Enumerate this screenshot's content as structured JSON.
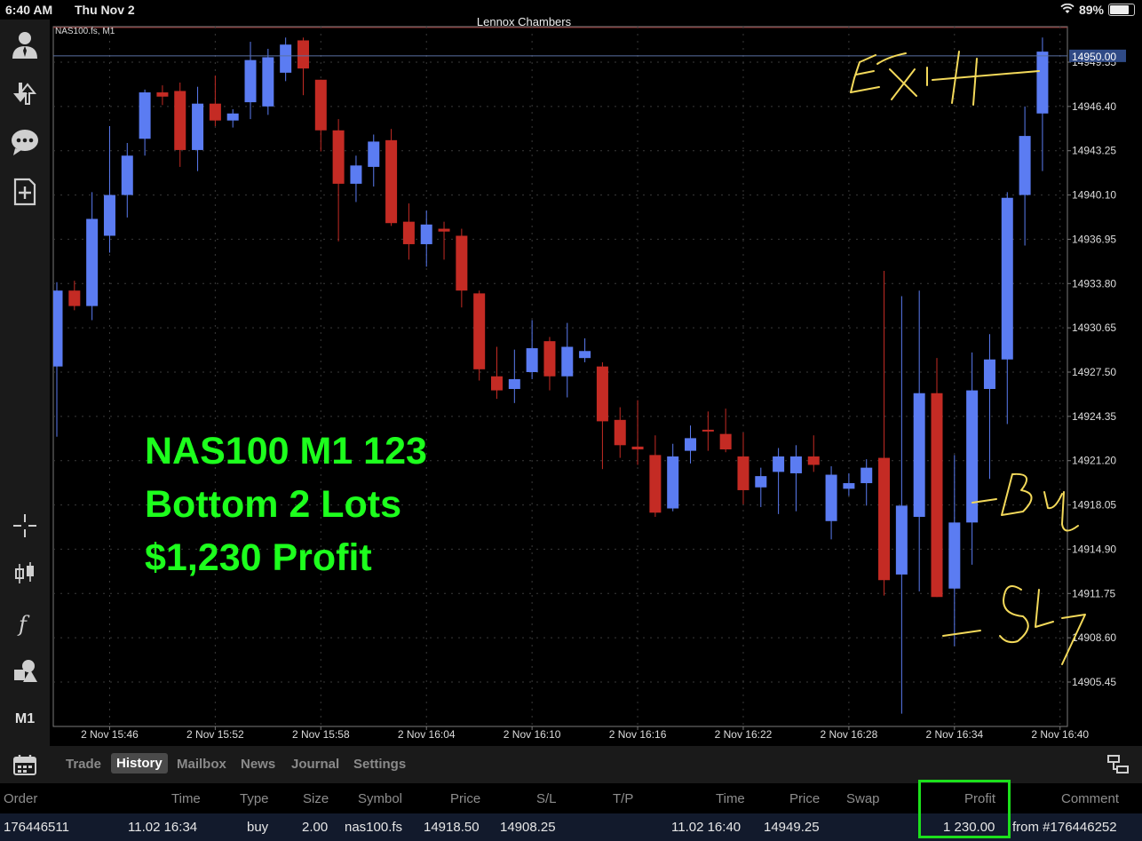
{
  "status_bar": {
    "time": "6:40 AM",
    "date": "Thu Nov 2",
    "battery": "89%",
    "battery_level": 0.89
  },
  "chart_header": {
    "account": "Lennox Chambers",
    "symbol": "NAS100.fs, M1"
  },
  "sidebar": {
    "tools": [
      "account-icon",
      "trade-icon",
      "chat-icon",
      "new-document-icon",
      "crosshair-icon",
      "candles-icon",
      "indicator-f-icon",
      "objects-icon"
    ],
    "timeframe": "M1"
  },
  "overlay": {
    "line1": "NAS100 M1 123",
    "line2": "Bottom 2 Lots",
    "line3": "$1,230 Profit"
  },
  "annotations": {
    "exit": "Exit",
    "buy": "Buy",
    "sl": "SL"
  },
  "colors": {
    "bull": "#5b7cf2",
    "bear": "#c42b24",
    "price_line": "#5a6fa3",
    "highlight": "#1ce01c",
    "overlay_text": "#1dff1d",
    "handwriting": "#f3d95a"
  },
  "chart_data": {
    "type": "candlestick",
    "current_price": "14950.00",
    "y_ticks": [
      "14949.55",
      "14946.40",
      "14943.25",
      "14940.10",
      "14936.95",
      "14933.80",
      "14930.65",
      "14927.50",
      "14924.35",
      "14921.20",
      "14918.05",
      "14914.90",
      "14911.75",
      "14908.60",
      "14905.45"
    ],
    "y_tick_values": [
      14949.55,
      14946.4,
      14943.25,
      14940.1,
      14936.95,
      14933.8,
      14930.65,
      14927.5,
      14924.35,
      14921.2,
      14918.05,
      14914.9,
      14911.75,
      14908.6,
      14905.45
    ],
    "ylim": [
      14902.8,
      14951.3
    ],
    "x_ticks": [
      "2 Nov 15:46",
      "2 Nov 15:52",
      "2 Nov 15:58",
      "2 Nov 16:04",
      "2 Nov 16:10",
      "2 Nov 16:16",
      "2 Nov 16:22",
      "2 Nov 16:28",
      "2 Nov 16:34",
      "2 Nov 16:40"
    ],
    "candles": [
      {
        "o": 14927.9,
        "h": 14933.9,
        "l": 14922.9,
        "c": 14933.3
      },
      {
        "o": 14933.3,
        "h": 14934.0,
        "l": 14931.9,
        "c": 14932.2
      },
      {
        "o": 14932.2,
        "h": 14940.3,
        "l": 14931.2,
        "c": 14938.4
      },
      {
        "o": 14937.2,
        "h": 14945.0,
        "l": 14936.0,
        "c": 14940.1
      },
      {
        "o": 14940.1,
        "h": 14943.8,
        "l": 14938.5,
        "c": 14942.9
      },
      {
        "o": 14944.1,
        "h": 14947.6,
        "l": 14942.9,
        "c": 14947.4
      },
      {
        "o": 14947.4,
        "h": 14947.9,
        "l": 14946.5,
        "c": 14947.1
      },
      {
        "o": 14947.5,
        "h": 14948.1,
        "l": 14942.1,
        "c": 14943.3
      },
      {
        "o": 14943.3,
        "h": 14947.8,
        "l": 14941.8,
        "c": 14946.6
      },
      {
        "o": 14946.6,
        "h": 14948.6,
        "l": 14945.0,
        "c": 14945.4
      },
      {
        "o": 14945.4,
        "h": 14946.2,
        "l": 14944.9,
        "c": 14945.9
      },
      {
        "o": 14946.7,
        "h": 14951.0,
        "l": 14945.5,
        "c": 14949.7
      },
      {
        "o": 14946.4,
        "h": 14950.5,
        "l": 14945.8,
        "c": 14949.9
      },
      {
        "o": 14948.8,
        "h": 14951.3,
        "l": 14948.2,
        "c": 14950.8
      },
      {
        "o": 14951.1,
        "h": 14951.3,
        "l": 14947.2,
        "c": 14949.1
      },
      {
        "o": 14948.3,
        "h": 14948.3,
        "l": 14943.2,
        "c": 14944.7
      },
      {
        "o": 14944.7,
        "h": 14945.5,
        "l": 14936.8,
        "c": 14940.9
      },
      {
        "o": 14940.9,
        "h": 14942.9,
        "l": 14939.6,
        "c": 14942.2
      },
      {
        "o": 14942.1,
        "h": 14944.4,
        "l": 14940.7,
        "c": 14943.9
      },
      {
        "o": 14944.0,
        "h": 14944.8,
        "l": 14937.9,
        "c": 14938.1
      },
      {
        "o": 14938.2,
        "h": 14939.5,
        "l": 14935.5,
        "c": 14936.6
      },
      {
        "o": 14936.6,
        "h": 14939.0,
        "l": 14935.0,
        "c": 14938.0
      },
      {
        "o": 14937.7,
        "h": 14938.2,
        "l": 14935.5,
        "c": 14937.5
      },
      {
        "o": 14937.2,
        "h": 14937.7,
        "l": 14932.1,
        "c": 14933.3
      },
      {
        "o": 14933.1,
        "h": 14933.3,
        "l": 14926.9,
        "c": 14927.7
      },
      {
        "o": 14927.2,
        "h": 14929.3,
        "l": 14925.6,
        "c": 14926.2
      },
      {
        "o": 14926.3,
        "h": 14929.1,
        "l": 14925.3,
        "c": 14927.0
      },
      {
        "o": 14927.5,
        "h": 14931.2,
        "l": 14927.0,
        "c": 14929.2
      },
      {
        "o": 14929.7,
        "h": 14930.0,
        "l": 14926.2,
        "c": 14927.2
      },
      {
        "o": 14927.2,
        "h": 14931.0,
        "l": 14925.7,
        "c": 14929.3
      },
      {
        "o": 14928.5,
        "h": 14929.9,
        "l": 14928.2,
        "c": 14929.0
      },
      {
        "o": 14927.9,
        "h": 14928.2,
        "l": 14920.6,
        "c": 14924.0
      },
      {
        "o": 14924.1,
        "h": 14925.0,
        "l": 14921.4,
        "c": 14922.3
      },
      {
        "o": 14922.2,
        "h": 14925.5,
        "l": 14920.9,
        "c": 14922.0
      },
      {
        "o": 14921.6,
        "h": 14923.0,
        "l": 14917.2,
        "c": 14917.5
      },
      {
        "o": 14917.8,
        "h": 14922.4,
        "l": 14917.6,
        "c": 14921.5
      },
      {
        "o": 14921.9,
        "h": 14923.7,
        "l": 14921.0,
        "c": 14922.8
      },
      {
        "o": 14923.4,
        "h": 14924.7,
        "l": 14921.9,
        "c": 14923.3
      },
      {
        "o": 14923.1,
        "h": 14924.9,
        "l": 14921.8,
        "c": 14922.0
      },
      {
        "o": 14921.5,
        "h": 14923.2,
        "l": 14918.1,
        "c": 14919.1
      },
      {
        "o": 14919.3,
        "h": 14920.7,
        "l": 14917.9,
        "c": 14920.1
      },
      {
        "o": 14920.4,
        "h": 14922.1,
        "l": 14917.4,
        "c": 14921.5
      },
      {
        "o": 14920.3,
        "h": 14922.3,
        "l": 14917.6,
        "c": 14921.5
      },
      {
        "o": 14921.5,
        "h": 14923.0,
        "l": 14920.4,
        "c": 14920.9
      },
      {
        "o": 14916.9,
        "h": 14920.8,
        "l": 14915.6,
        "c": 14920.2
      },
      {
        "o": 14919.2,
        "h": 14920.3,
        "l": 14918.7,
        "c": 14919.6
      },
      {
        "o": 14919.6,
        "h": 14921.3,
        "l": 14918.0,
        "c": 14920.7
      },
      {
        "o": 14921.4,
        "h": 14934.7,
        "l": 14911.6,
        "c": 14912.7
      },
      {
        "o": 14913.1,
        "h": 14932.9,
        "l": 14903.2,
        "c": 14918.0
      },
      {
        "o": 14917.2,
        "h": 14933.3,
        "l": 14911.9,
        "c": 14926.0
      },
      {
        "o": 14926.0,
        "h": 14928.5,
        "l": 14911.5,
        "c": 14911.5
      },
      {
        "o": 14912.1,
        "h": 14921.6,
        "l": 14908.0,
        "c": 14916.8
      },
      {
        "o": 14916.8,
        "h": 14928.9,
        "l": 14913.8,
        "c": 14926.2
      },
      {
        "o": 14926.3,
        "h": 14930.2,
        "l": 14919.9,
        "c": 14928.4
      },
      {
        "o": 14928.4,
        "h": 14940.3,
        "l": 14923.8,
        "c": 14939.9
      },
      {
        "o": 14940.1,
        "h": 14946.4,
        "l": 14936.5,
        "c": 14944.3
      },
      {
        "o": 14945.9,
        "h": 14951.3,
        "l": 14941.8,
        "c": 14950.3
      }
    ]
  },
  "bottom_tabs": {
    "trade": "Trade",
    "history": "History",
    "mailbox": "Mailbox",
    "news": "News",
    "journal": "Journal",
    "settings": "Settings"
  },
  "history_table": {
    "headers": {
      "order": "Order",
      "time1": "Time",
      "type": "Type",
      "size": "Size",
      "symbol": "Symbol",
      "price1": "Price",
      "sl": "S/L",
      "tp": "T/P",
      "time2": "Time",
      "price2": "Price",
      "swap": "Swap",
      "profit": "Profit",
      "comment": "Comment"
    },
    "row": {
      "order": "176446511",
      "time1": "11.02 16:34",
      "type": "buy",
      "size": "2.00",
      "symbol": "nas100.fs",
      "price1": "14918.50",
      "sl": "14908.25",
      "tp": "",
      "time2": "11.02 16:40",
      "price2": "14949.25",
      "swap": "",
      "profit": "1 230.00",
      "comment": "from #176446252"
    }
  }
}
